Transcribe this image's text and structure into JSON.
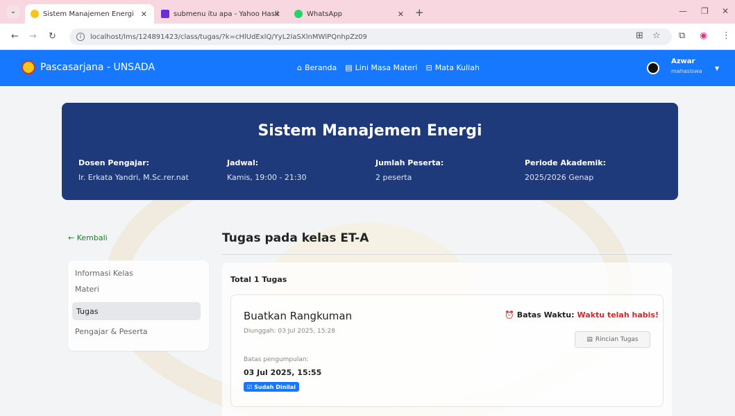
{
  "browser": {
    "tabs": [
      {
        "title": "Sistem Manajemen Energi",
        "active": true
      },
      {
        "title": "submenu itu apa - Yahoo Hasil",
        "active": false
      },
      {
        "title": "WhatsApp",
        "active": false
      }
    ],
    "url": "localhost/lms/124891423/class/tugas/?k=cHlUdExlQ/YyL2laSXlnMWlPQnhpZz09"
  },
  "appnav": {
    "brand": "Pascasarjana - UNSADA",
    "links": [
      {
        "label": "Beranda",
        "icon": "home-icon"
      },
      {
        "label": "Lini Masa Materi",
        "icon": "timeline-icon"
      },
      {
        "label": "Mata Kuliah",
        "icon": "book-icon"
      }
    ],
    "user": {
      "name": "Azwar",
      "role": "mahasiswa"
    }
  },
  "course": {
    "title": "Sistem Manajemen Energi",
    "meta": [
      {
        "label": "Dosen Pengajar:",
        "value": "Ir. Erkata Yandri, M.Sc.rer.nat"
      },
      {
        "label": "Jadwal:",
        "value": "Kamis, 19:00 - 21:30"
      },
      {
        "label": "Jumlah Peserta:",
        "value": "2 peserta"
      },
      {
        "label": "Periode Akademik:",
        "value": "2025/2026 Genap"
      }
    ]
  },
  "sidebar": {
    "back": "← Kembali",
    "items": [
      "Informasi Kelas",
      "Materi",
      "Tugas",
      "Pengajar & Peserta"
    ],
    "active_index": 2
  },
  "main": {
    "title": "Tugas pada kelas ET-A",
    "total": "Total 1 Tugas",
    "task": {
      "name": "Buatkan Rangkuman",
      "uploaded": "Diunggah: 03 Jul 2025, 15:28",
      "deadline_label": "Batas pengumpulan:",
      "deadline": "03 Jul 2025, 15:55",
      "badge": "Sudah Dinilai",
      "due_label": "Batas Waktu:",
      "due_value": "Waktu telah habis!",
      "details_button": "Rincian Tugas"
    }
  },
  "colors": {
    "accent": "#1677ff",
    "header": "#1f3a7a",
    "danger": "#d4262c"
  }
}
